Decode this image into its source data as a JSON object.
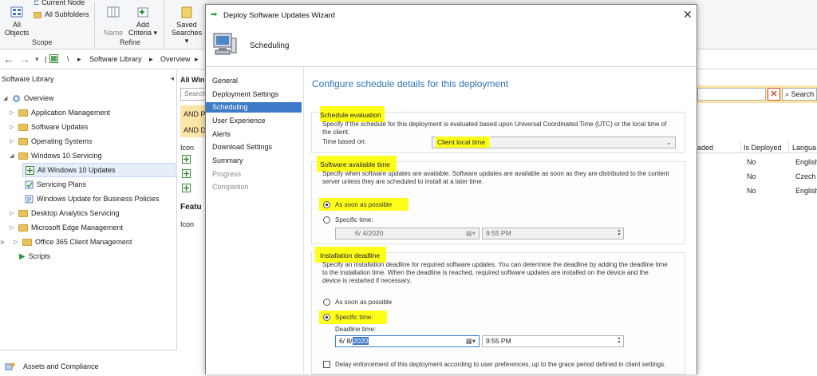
{
  "ribbon": {
    "current_node": "Current Node",
    "all_subfolders": "All Subfolders",
    "all_objects_line1": "All",
    "all_objects_line2": "Objects",
    "scope": "Scope",
    "name": "Name",
    "add_criteria_line1": "Add",
    "add_criteria_line2": "Criteria",
    "refine": "Refine",
    "saved_searches_line1": "Saved",
    "saved_searches_line2": "Searches"
  },
  "breadcrumb": {
    "root": "\\",
    "item1": "Software Library",
    "item2": "Overview"
  },
  "left_nav": {
    "header": "Software Library",
    "items": [
      {
        "label": "Overview"
      },
      {
        "label": "Application Management"
      },
      {
        "label": "Software Updates"
      },
      {
        "label": "Operating Systems"
      },
      {
        "label": "Windows 10 Servicing"
      },
      {
        "label": "All Windows 10 Updates"
      },
      {
        "label": "Servicing Plans"
      },
      {
        "label": "Windows Update for Business Policies"
      },
      {
        "label": "Desktop Analytics Servicing"
      },
      {
        "label": "Microsoft Edge Management"
      },
      {
        "label": "Office 365 Client Management"
      },
      {
        "label": "Scripts"
      }
    ],
    "footer": "Assets and Compliance"
  },
  "main_list": {
    "tab_title": "All Win",
    "search_placeholder": "Search",
    "search_button": "Search",
    "and_row_1": "AND P",
    "and_row_2": "AND D",
    "columns": {
      "icon": "Icon",
      "downloaded": "aded",
      "is_deployed": "Is Deployed",
      "language": "Langua"
    },
    "rows": [
      {
        "is_deployed": "No",
        "language": "English"
      },
      {
        "is_deployed": "No",
        "language": "Czech"
      },
      {
        "is_deployed": "No",
        "language": "English"
      }
    ],
    "feature_title": "Featu",
    "feature_icon_col": "Icon"
  },
  "dialog": {
    "title": "Deploy Software Updates Wizard",
    "header": "Scheduling",
    "nav": [
      {
        "label": "General",
        "state": "normal"
      },
      {
        "label": "Deployment Settings",
        "state": "normal"
      },
      {
        "label": "Scheduling",
        "state": "active"
      },
      {
        "label": "User Experience",
        "state": "normal"
      },
      {
        "label": "Alerts",
        "state": "normal"
      },
      {
        "label": "Download Settings",
        "state": "normal"
      },
      {
        "label": "Summary",
        "state": "normal"
      },
      {
        "label": "Progress",
        "state": "dim"
      },
      {
        "label": "Completion",
        "state": "dim"
      }
    ],
    "page_title": "Configure schedule details for this deployment",
    "schedule_eval": {
      "title": "Schedule evaluation",
      "desc_line1": "Specify if the schedule for this deployment is evaluated based upon Universal Coordinated Time (UTC) or the local time of",
      "desc_line2": "the client.",
      "time_based_label": "Time based on:",
      "time_based_value": "Client local time"
    },
    "available_time": {
      "title": "Software available time",
      "desc_line1": "Specify when software updates are available. Software updates are available as soon as they are distributed to the content",
      "desc_line2": "server unless they are scheduled to install at a later time.",
      "asap_label": "As soon as possible",
      "specific_label": "Specific time:",
      "date_value": "6/  4/2020",
      "time_value": "9:55 PM"
    },
    "deadline": {
      "title": "Installation deadline",
      "desc_line1": "Specify an installation deadline for required software updates. You can determine the deadline by adding the deadline time",
      "desc_line2": "to the installation time. When the deadline is reached, required software updates are installed on the device and the",
      "desc_line3": "device is restarted if necessary.",
      "asap_label": "As soon as possible",
      "specific_label": "Specific time:",
      "deadline_label": "Deadline time:",
      "date_prefix": "6/  8/",
      "date_year": "2020",
      "time_value": "9:55 PM",
      "delay_label": "Delay enforcement of this deployment according to user preferences, up to the grace period defined in client settings."
    }
  },
  "colors": {
    "accent": "#3f7bc8",
    "highlight": "#ffff1a",
    "title_blue": "#2e74b5",
    "filter_row": "#fce5a8"
  }
}
